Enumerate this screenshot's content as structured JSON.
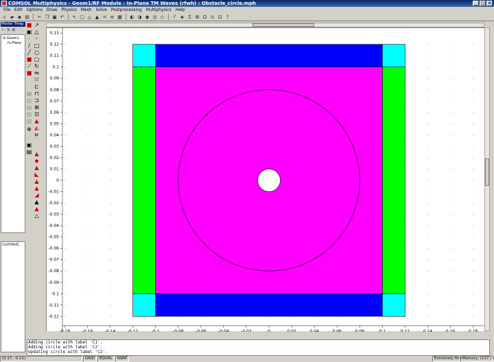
{
  "window": {
    "title": "COMSOL Multiphysics - Geom1/RF Module - In-Plane TM Waves (rfwh) : Obstacle_circle.mph"
  },
  "menu": [
    "File",
    "Edit",
    "Options",
    "Draw",
    "Physics",
    "Mesh",
    "Solve",
    "Postprocessing",
    "Multiphysics",
    "Help"
  ],
  "model_tree": {
    "header": "Model Tree",
    "items": [
      "Geom1",
      "In-Plane"
    ]
  },
  "console": {
    "lines": [
      "Adding circle with label 'C1'.",
      "Adding circle with label 'C2'.",
      "Updating circle with label 'C2'."
    ]
  },
  "untitled_label": "[untitled]",
  "status": {
    "coords": "(0.17, -0.11)",
    "grid": "GRID",
    "equal": "EQUAL",
    "snap": "SNAP",
    "mesh": "Extremely fine",
    "memory": "Memory: (117 / 124)"
  },
  "axes": {
    "x_ticks": [
      "-0.18",
      "-0.16",
      "-0.14",
      "-0.12",
      "-0.1",
      "-0.08",
      "-0.06",
      "-0.04",
      "-0.02",
      "0",
      "0.02",
      "0.04",
      "0.06",
      "0.08",
      "0.1",
      "0.12",
      "0.14",
      "0.16",
      "0.18"
    ],
    "y_ticks": [
      "0.13",
      "0.12",
      "0.11",
      "0.1",
      "0.09",
      "0.08",
      "0.07",
      "0.06",
      "0.05",
      "0.04",
      "0.03",
      "0.02",
      "0.01",
      "0",
      "-0.01",
      "-0.02",
      "-0.03",
      "-0.04",
      "-0.05",
      "-0.06",
      "-0.07",
      "-0.08",
      "-0.09",
      "-0.1",
      "-0.11",
      "-0.12"
    ]
  },
  "colors": {
    "pml_corner": "#00ffff",
    "pml_top_bottom": "#0000ff",
    "pml_sides": "#00ff00",
    "domain": "#ff00ff",
    "hole": "#ffffff"
  },
  "icons": {
    "toolbar": [
      "new-icon",
      "open-icon",
      "save-icon",
      "print-icon",
      "cut-icon",
      "copy-icon",
      "paste-icon",
      "undo-icon",
      "pointer-icon",
      "zoom-icon",
      "mesh-icon",
      "solve-icon",
      "plot-icon",
      "help-icon"
    ]
  }
}
